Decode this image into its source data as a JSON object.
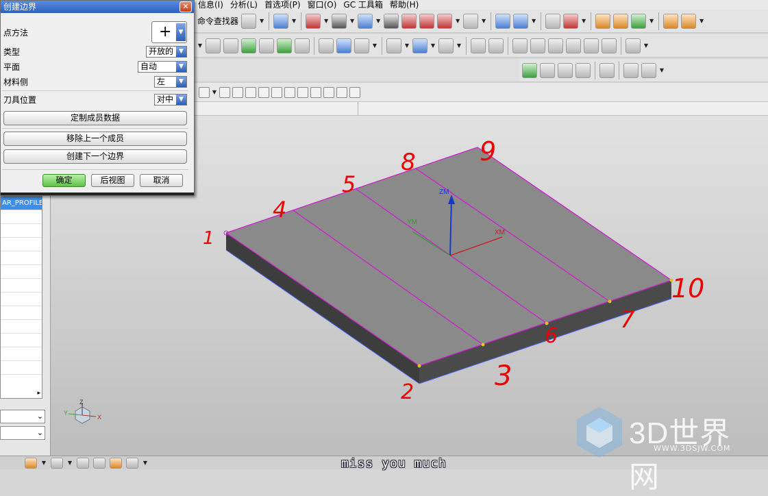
{
  "menu": [
    "信息(I)",
    "分析(L)",
    "首选项(P)",
    "窗口(O)",
    "GC 工具箱",
    "帮助(H)"
  ],
  "toolbar": {
    "command_finder": "命令查找器"
  },
  "dialog": {
    "title": "创建边界",
    "point_method_label": "点方法",
    "type_label": "类型",
    "type_value": "开放的",
    "plane_label": "平面",
    "plane_value": "自动",
    "material_side_label": "材料侧",
    "material_side_value": "左",
    "tool_position_label": "刀具位置",
    "tool_position_value": "对中",
    "custom_member_data": "定制成员数据",
    "remove_last_member": "移除上一个成员",
    "create_next_boundary": "创建下一个边界",
    "ok": "确定",
    "back": "后视图",
    "cancel": "取消"
  },
  "navigator": {
    "selected_item": "AR_PROFILE"
  },
  "viewport": {
    "axes": {
      "zm": "ZM",
      "ym": "YM",
      "xm": "XM"
    },
    "triad": {
      "x": "X",
      "y": "Y",
      "z": "Z"
    },
    "annotations": [
      "1",
      "2",
      "3",
      "4",
      "5",
      "6",
      "7",
      "8",
      "9",
      "10"
    ],
    "annotation_color": "#ee0000",
    "edge_color": "#cc22cc"
  },
  "subtitle": "miss you much",
  "watermark": {
    "text": "3D世界网",
    "url": "WWW.3DSJW.COM"
  }
}
